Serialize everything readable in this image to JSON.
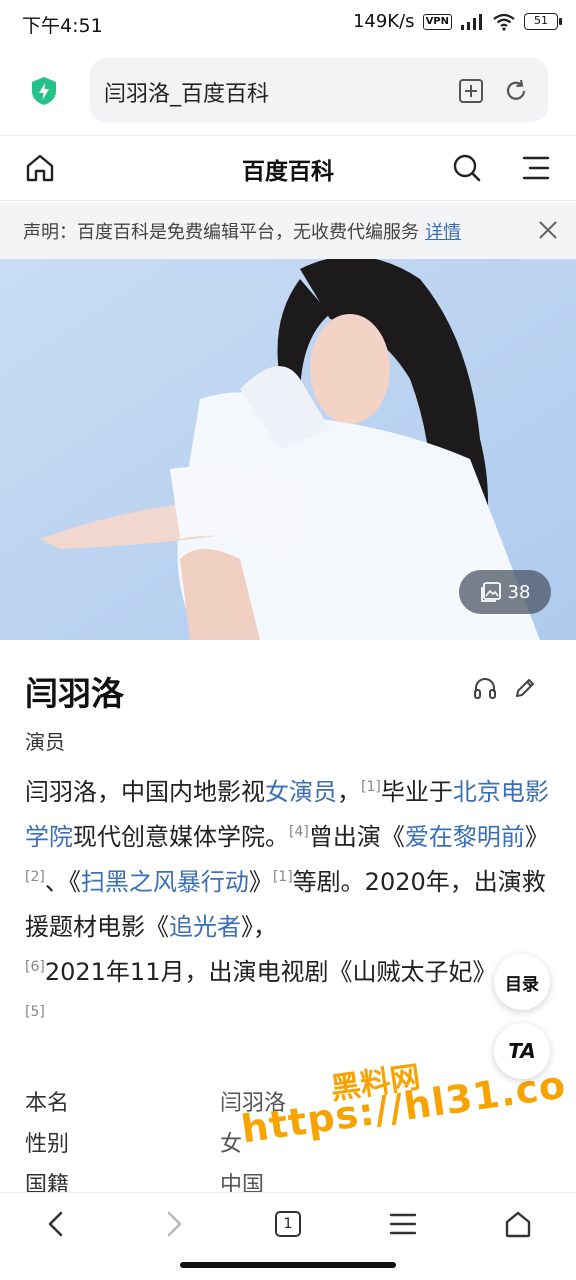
{
  "status": {
    "time": "下午4:51",
    "speed": "149K/s",
    "vpn": "VPN",
    "battery": "51"
  },
  "browser": {
    "url_title": "闫羽洛_百度百科"
  },
  "site": {
    "title": "百度百科"
  },
  "notice": {
    "text": "声明：百度百科是免费编辑平台，无收费代编服务",
    "link": "详情"
  },
  "hero": {
    "photo_count": "38"
  },
  "article": {
    "name": "闫羽洛",
    "subtitle": "演员",
    "summary": {
      "p1": "闫羽洛，中国内地影视",
      "l1": "女演员",
      "p2": "，",
      "r1": "[1]",
      "p3": "毕业于",
      "l2": "北京电影学院",
      "p4": "现代创意媒体学院。",
      "r2": "[4]",
      "p5": "曾出演《",
      "l3": "爱在黎明前",
      "p6": "》",
      "r3": "[2]",
      "p7": "、《",
      "l4": "扫黑之风暴行动",
      "p8": "》",
      "r4": "[1]",
      "p9": "等剧。2020年，出演救援题材电影《",
      "l5": "追光者",
      "p10": "》，",
      "r5": "[6]",
      "p11": "2021年11月，出演电视剧《山贼太子妃》",
      "r6": "[5]"
    },
    "infobox": [
      {
        "key": "本名",
        "value": "闫羽洛"
      },
      {
        "key": "性别",
        "value": "女"
      },
      {
        "key": "国籍",
        "value": "中国"
      }
    ]
  },
  "floating": {
    "toc": "目录",
    "ta": "TA"
  },
  "watermark": {
    "line1": "黑料网",
    "line2": "https://hl31.co"
  },
  "bottom_nav": {
    "tab_count": "1"
  },
  "colors": {
    "link": "#3a6fb6",
    "notice_bg": "#f3f4f6",
    "shield": "#25c18a",
    "watermark": "#f7a400"
  }
}
